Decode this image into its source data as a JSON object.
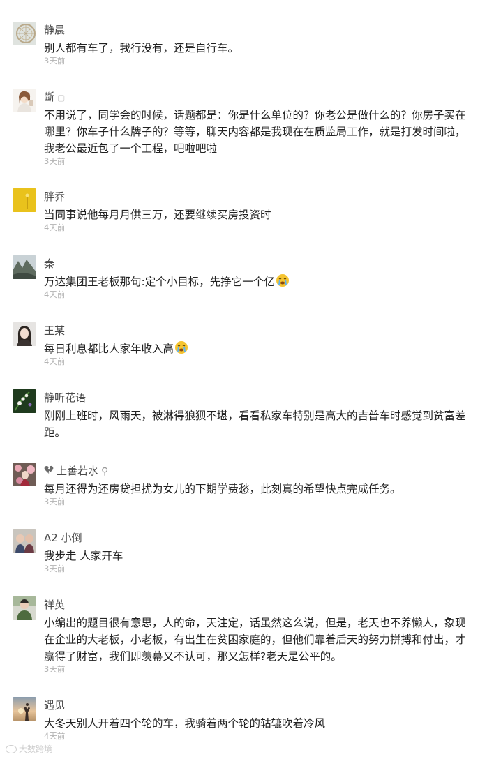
{
  "comments": [
    {
      "name": "静晨",
      "text": "别人都有车了，我行没有，还是自行车。",
      "time": "3天前",
      "avatar": "ferris-wheel-avatar"
    },
    {
      "name": "斷",
      "badge": "▢",
      "text": "不用说了，同学会的时候，话题都是：你是什么单位的？你老公是做什么的？你房子买在哪里？你车子什么牌子的？等等，聊天内容都是我现在在质监局工作，就是打发时间啦，我老公最近包了一个工程，吧啦吧啦",
      "time": "3天前",
      "avatar": "girl-cartoon-avatar"
    },
    {
      "name": "胖乔",
      "text": "当同事说他每月月供三万，还要继续买房投资时",
      "time": "4天前",
      "avatar": "yellow-flower-avatar"
    },
    {
      "name": "秦",
      "text": "万达集团王老板那句:定个小目标，先挣它一个亿",
      "time": "4天前",
      "avatar": "landscape-avatar",
      "emoji": "crying-face-emoji"
    },
    {
      "name": "王某",
      "text": "每日利息都比人家年收入高",
      "time": "4天前",
      "avatar": "woman-portrait-avatar",
      "emoji": "crying-face-emoji"
    },
    {
      "name": "静听花语",
      "text": "刚刚上班时，风雨天，被淋得狼狈不堪，看看私家车特别是高大的吉普车时感觉到贫富差距。",
      "time": "",
      "avatar": "lily-flower-avatar"
    },
    {
      "name": "上善若水",
      "name_prefix_icon": "broken-heart-icon",
      "name_suffix": "♀",
      "text": "每月还得为还房贷担扰为女儿的下期学费愁，此刻真的希望快点完成任务。",
      "time": "3天前",
      "avatar": "pink-blossom-avatar"
    },
    {
      "name": "A2 小倒",
      "text": "我步走 人家开车",
      "time": "3天前",
      "avatar": "two-kids-avatar"
    },
    {
      "name": "祥英",
      "text": "小编出的题目很有意思，人的命，天注定，话虽然这么说，但是，老天也不养懒人，象现在企业的大老板，小老板，有出生在贫困家庭的，但他们靠着后天的努力拼搏和付出，才赢得了财富，我们即羡幕又不认可，那又怎样?老天是公平的。",
      "time": "3天前",
      "avatar": "person-green-avatar"
    },
    {
      "name": "遇见",
      "text": "大冬天别人开着四个轮的车，我骑着两个轮的轱辘吹着冷风",
      "time": "4天前",
      "avatar": "sunset-silhouette-avatar"
    }
  ],
  "watermark": "大数跨境"
}
